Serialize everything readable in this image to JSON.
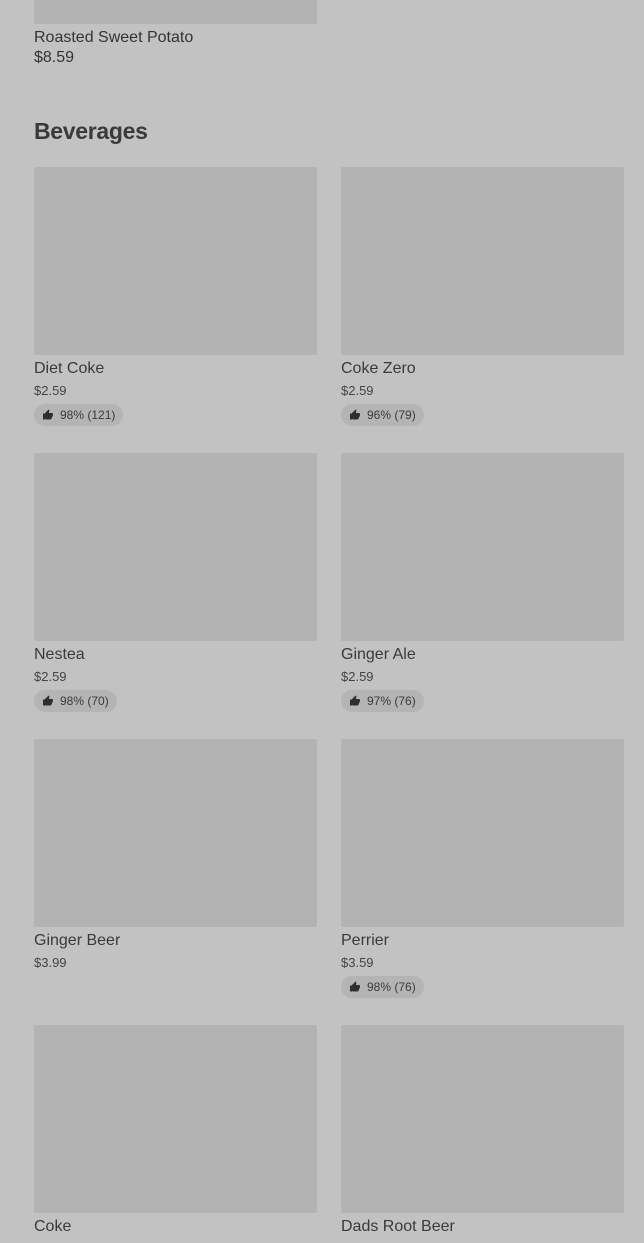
{
  "top_item": {
    "name": "Roasted Sweet Potato",
    "price": "$8.59"
  },
  "section": {
    "title": "Beverages"
  },
  "items": [
    {
      "name": "Diet Coke",
      "price": "$2.59",
      "rating": "98% (121)"
    },
    {
      "name": "Coke Zero",
      "price": "$2.59",
      "rating": "96% (79)"
    },
    {
      "name": "Nestea",
      "price": "$2.59",
      "rating": "98% (70)"
    },
    {
      "name": "Ginger Ale",
      "price": "$2.59",
      "rating": "97% (76)"
    },
    {
      "name": "Ginger Beer",
      "price": "$3.99",
      "rating": ""
    },
    {
      "name": "Perrier",
      "price": "$3.59",
      "rating": "98% (76)"
    },
    {
      "name": "Coke",
      "price": "",
      "rating": ""
    },
    {
      "name": "Dads Root Beer",
      "price": "",
      "rating": ""
    }
  ],
  "icons": {
    "rating": "thumbs-up-icon"
  },
  "colors": {
    "background": "#c2c2c2",
    "image_placeholder": "#b3b3b3",
    "text": "#333333"
  }
}
